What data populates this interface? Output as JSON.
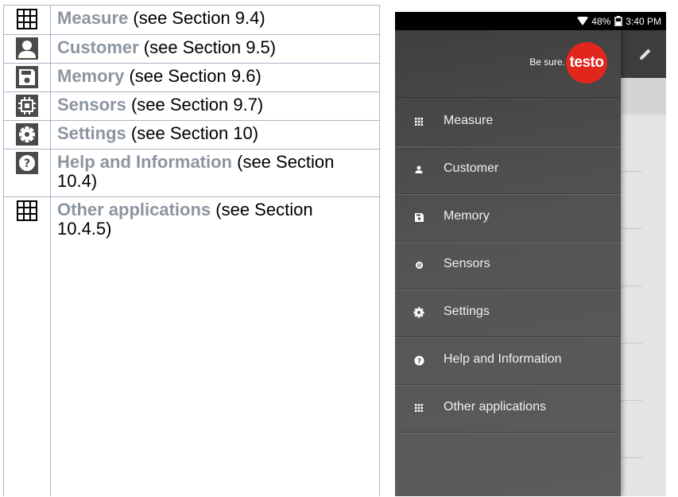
{
  "doc_rows": [
    {
      "term": "Measure",
      "rest": " (see Section 9.4)",
      "icon": "grid-icon"
    },
    {
      "term": "Customer",
      "rest": " (see Section 9.5)",
      "icon": "person-icon"
    },
    {
      "term": "Memory",
      "rest": " (see Section 9.6)",
      "icon": "save-icon"
    },
    {
      "term": "Sensors",
      "rest": " (see Section 9.7)",
      "icon": "chip-icon"
    },
    {
      "term": "Settings",
      "rest": " (see Section 10)",
      "icon": "gear-icon"
    },
    {
      "term": "Help and Information",
      "rest": " (see Section 10.4)",
      "icon": "help-icon"
    },
    {
      "term": "Other applications",
      "rest": " (see Section 10.4.5)",
      "icon": "grid-icon"
    }
  ],
  "phone": {
    "status": {
      "battery": "48%",
      "time": "3:40 PM"
    },
    "brand": {
      "tagline": "Be sure.",
      "logo": "testo"
    },
    "menu": [
      {
        "label": "Measure",
        "icon": "apps-icon"
      },
      {
        "label": "Customer",
        "icon": "person-icon"
      },
      {
        "label": "Memory",
        "icon": "save-icon"
      },
      {
        "label": "Sensors",
        "icon": "chip-icon"
      },
      {
        "label": "Settings",
        "icon": "gear-icon"
      },
      {
        "label": "Help and Information",
        "icon": "help-icon"
      },
      {
        "label": "Other applications",
        "icon": "apps-icon"
      }
    ]
  },
  "colors": {
    "term": "#8c96a0",
    "accent": "#e1261c",
    "drawer": "#4a4a4a"
  }
}
